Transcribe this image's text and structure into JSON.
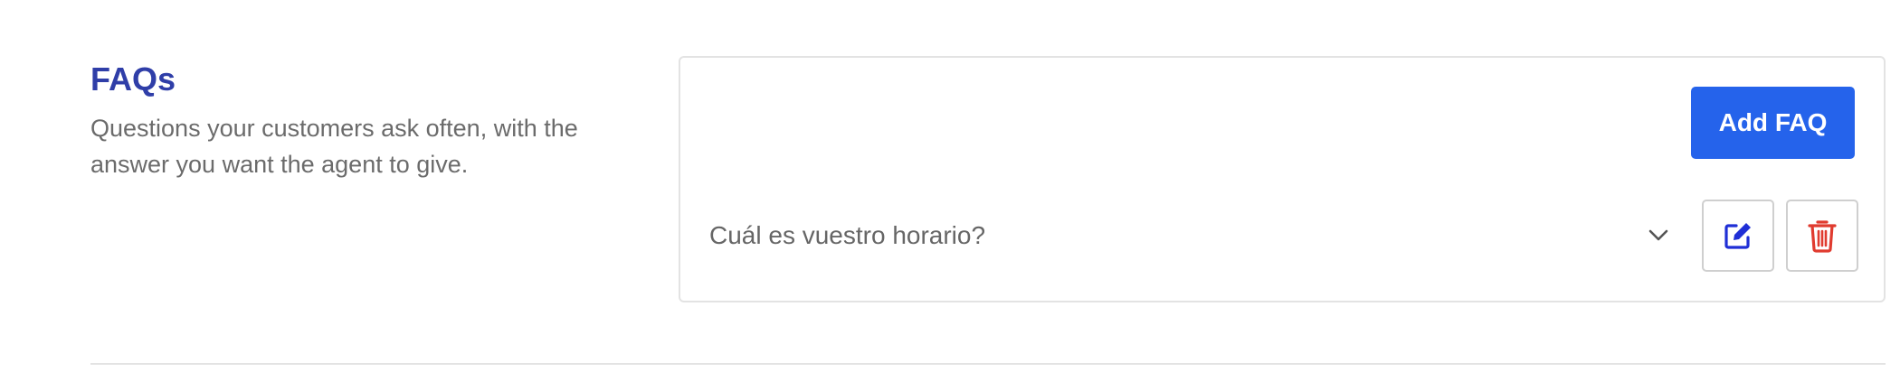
{
  "section": {
    "title": "FAQs",
    "description": "Questions your customers ask often, with the answer you want the agent to give."
  },
  "toolbar": {
    "add_label": "Add FAQ"
  },
  "faqs": [
    {
      "question": "Cuál es vuestro horario?",
      "expand_icon": "chevron-down-icon",
      "edit_icon": "edit-icon",
      "delete_icon": "trash-icon"
    }
  ],
  "colors": {
    "title": "#2f3ea8",
    "primary": "#2563eb",
    "edit_icon": "#1f2fd6",
    "delete_icon": "#e03b2f",
    "muted_text": "#6b6b6b",
    "border": "#e3e3e3"
  }
}
